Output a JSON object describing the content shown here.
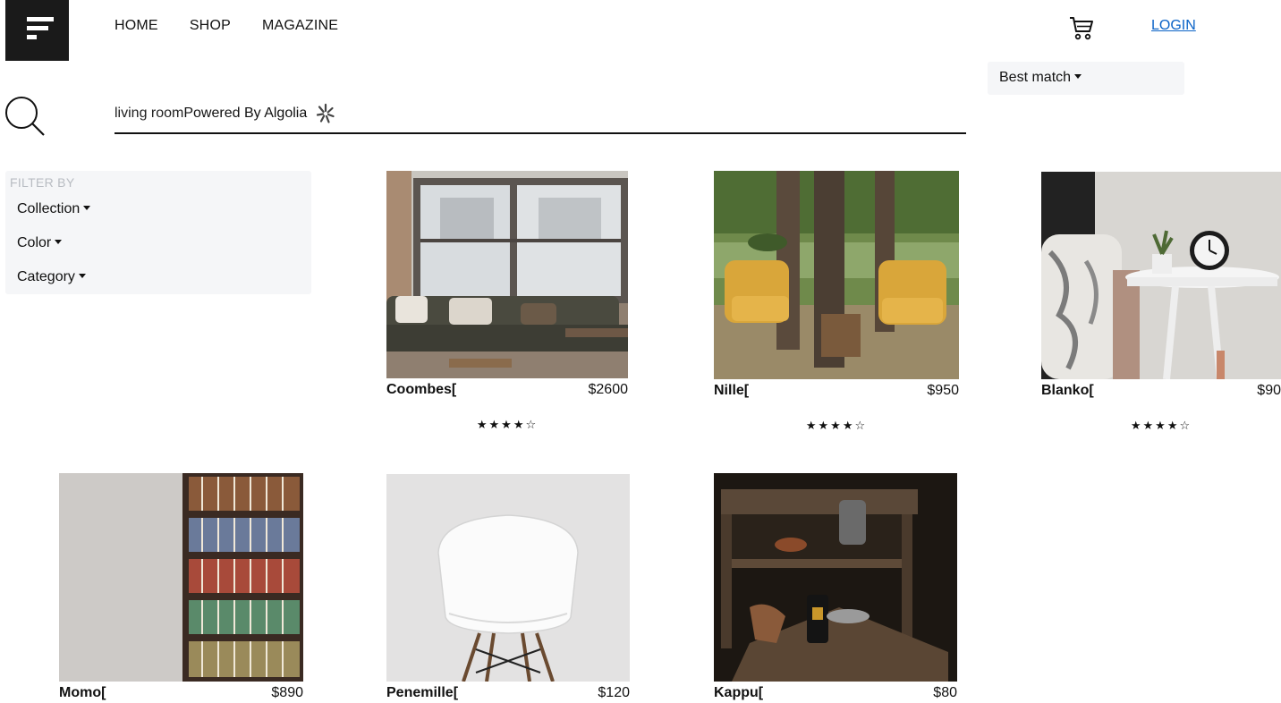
{
  "header": {
    "nav": [
      "HOME",
      "SHOP",
      "MAGAZINE"
    ],
    "login_label": "LOGIN"
  },
  "search": {
    "query": "living room",
    "powered_by": "Powered By Algolia"
  },
  "sort": {
    "label": "Best match"
  },
  "filters": {
    "title": "FILTER BY",
    "items": [
      "Collection",
      "Color",
      "Category"
    ]
  },
  "products": [
    {
      "name": "Coombes[",
      "price": "$2600",
      "stars": "★★★★☆",
      "rating": 4
    },
    {
      "name": "Nille[",
      "price": "$950",
      "stars": "★★★★☆",
      "rating": 4
    },
    {
      "name": "Blanko[",
      "price": "$90",
      "stars": "★★★★☆",
      "rating": 4
    },
    {
      "name": "Momo[",
      "price": "$890"
    },
    {
      "name": "Penemille[",
      "price": "$120"
    },
    {
      "name": "Kappu[",
      "price": "$80"
    }
  ],
  "icons": [
    "menu-logo-icon",
    "cart-icon",
    "search-icon",
    "algolia-icon",
    "caret-down-icon",
    "star-icon"
  ]
}
